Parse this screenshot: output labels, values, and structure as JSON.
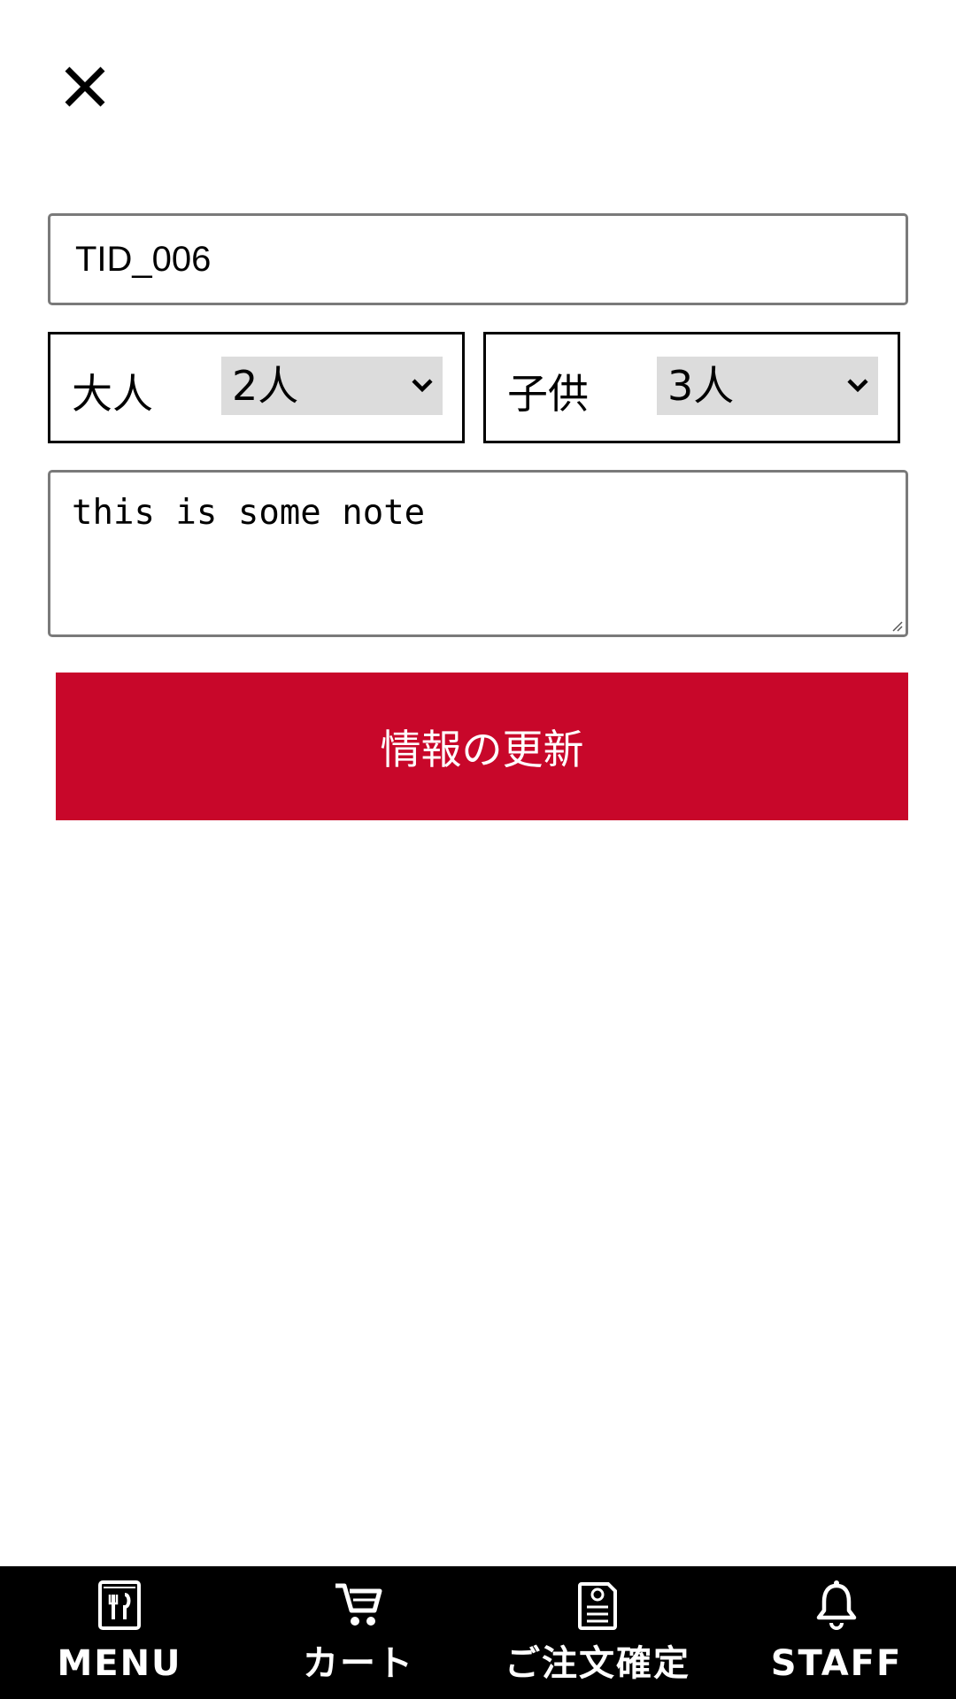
{
  "header": {
    "close_icon": "close-icon"
  },
  "form": {
    "table_id_value": "TID_006",
    "adult": {
      "label": "大人",
      "selected": "2人"
    },
    "child": {
      "label": "子供",
      "selected": "3人"
    },
    "note_value": "this is some note",
    "update_button_label": "情報の更新"
  },
  "bottom_nav": {
    "items": [
      {
        "label": "MENU",
        "icon": "menu-book-icon"
      },
      {
        "label": "カート",
        "icon": "cart-icon"
      },
      {
        "label": "ご注文確定",
        "icon": "order-confirm-icon"
      },
      {
        "label": "STAFF",
        "icon": "bell-icon"
      }
    ]
  },
  "colors": {
    "accent": "#c8072a",
    "nav_background": "#000000",
    "select_background": "#dcdcdc"
  }
}
